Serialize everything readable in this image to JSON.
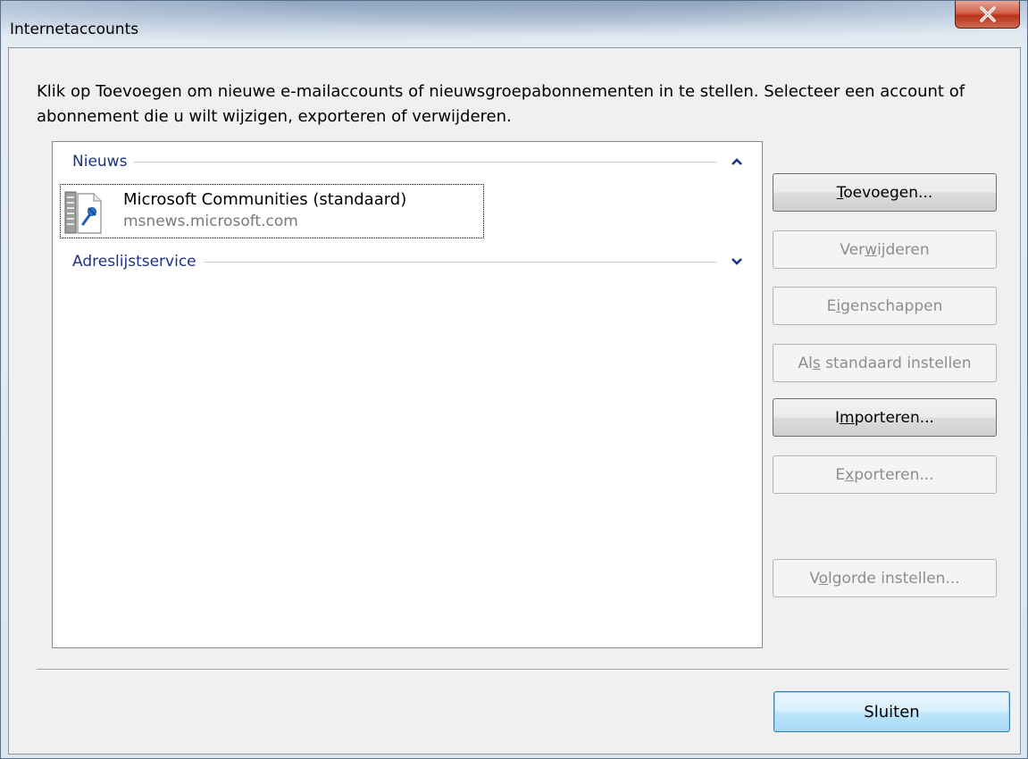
{
  "window": {
    "title": "Internetaccounts",
    "close_glyph": "X"
  },
  "instructions": "Klik op Toevoegen om nieuwe e-mailaccounts of nieuwsgroepabonnementen in te stellen. Selecteer een account of abonnement die u wilt wijzigen, exporteren of verwijderen.",
  "accounts_list": {
    "groups": [
      {
        "label": "Nieuws",
        "state": "expanded",
        "chevron_icon": "chevron-up-icon",
        "items": [
          {
            "name": "Microsoft Communities (standaard)",
            "server": "msnews.microsoft.com",
            "icon": "news-server-icon"
          }
        ]
      },
      {
        "label": "Adreslijstservice",
        "state": "collapsed",
        "chevron_icon": "chevron-down-icon",
        "items": []
      }
    ]
  },
  "buttons": {
    "add": {
      "label": "Toevoegen...",
      "accesskey": "T",
      "enabled": true
    },
    "remove": {
      "label": "Verwijderen",
      "accesskey": "w",
      "enabled": false
    },
    "properties": {
      "label": "Eigenschappen",
      "accesskey": "i",
      "enabled": false
    },
    "set_default": {
      "label": "Als standaard instellen",
      "accesskey": "s",
      "enabled": false
    },
    "import": {
      "label": "Importeren...",
      "accesskey": "m",
      "enabled": true
    },
    "export": {
      "label": "Exporteren...",
      "accesskey": "x",
      "enabled": false
    },
    "order": {
      "label": "Volgorde instellen...",
      "accesskey": "o",
      "enabled": false
    }
  },
  "close_button": {
    "label": "Sluiten"
  },
  "colors": {
    "group_header": "#1e3287",
    "disabled_text": "#8d8d8d",
    "close_button_red": "#c7442c"
  }
}
